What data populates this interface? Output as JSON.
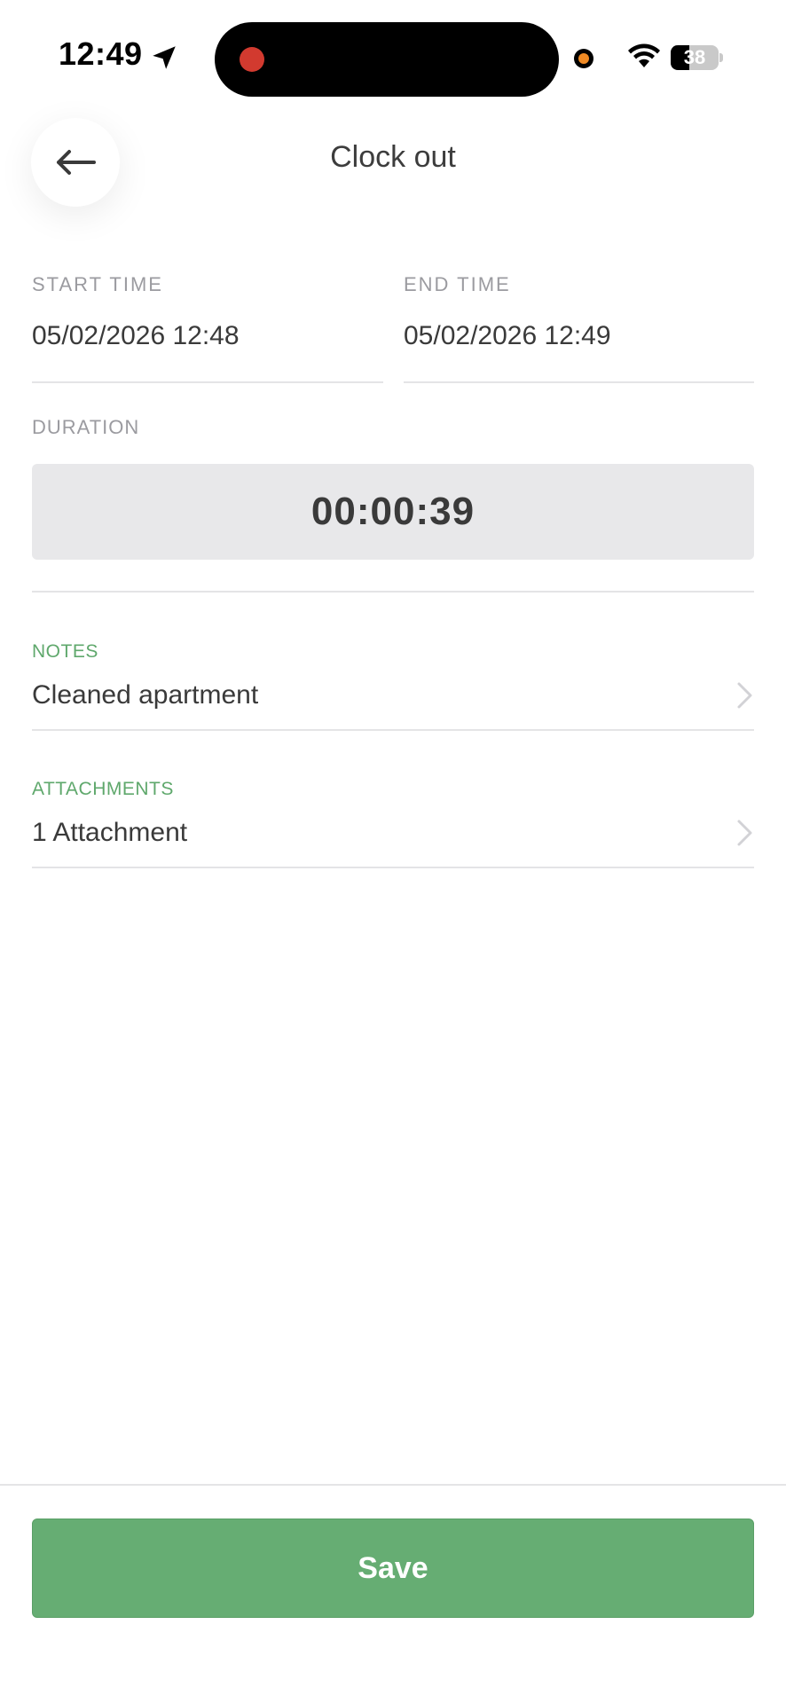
{
  "status_bar": {
    "time": "12:49",
    "battery": "38",
    "battery_level_percent": 38,
    "icons": [
      "location-arrow-icon",
      "recording-dot-icon",
      "mic-indicator-icon",
      "wifi-icon",
      "battery-icon"
    ]
  },
  "header": {
    "title": "Clock out",
    "back_icon": "arrow-left-icon"
  },
  "start_time": {
    "label": "START TIME",
    "value": "05/02/2026 12:48"
  },
  "end_time": {
    "label": "END TIME",
    "value": "05/02/2026 12:49"
  },
  "duration": {
    "label": "DURATION",
    "value": "00:00:39"
  },
  "notes": {
    "label": "NOTES",
    "value": "Cleaned apartment",
    "icon": "chevron-right-icon"
  },
  "attachments": {
    "label": "ATTACHMENTS",
    "value": "1 Attachment",
    "icon": "chevron-right-icon"
  },
  "save_button": {
    "label": "Save"
  },
  "colors": {
    "accent_green": "#66ad73",
    "label_green": "#5fa86c",
    "duration_background": "#e8e8ea",
    "recording_red": "#d23a2f",
    "indicator_orange": "#f08a24"
  }
}
